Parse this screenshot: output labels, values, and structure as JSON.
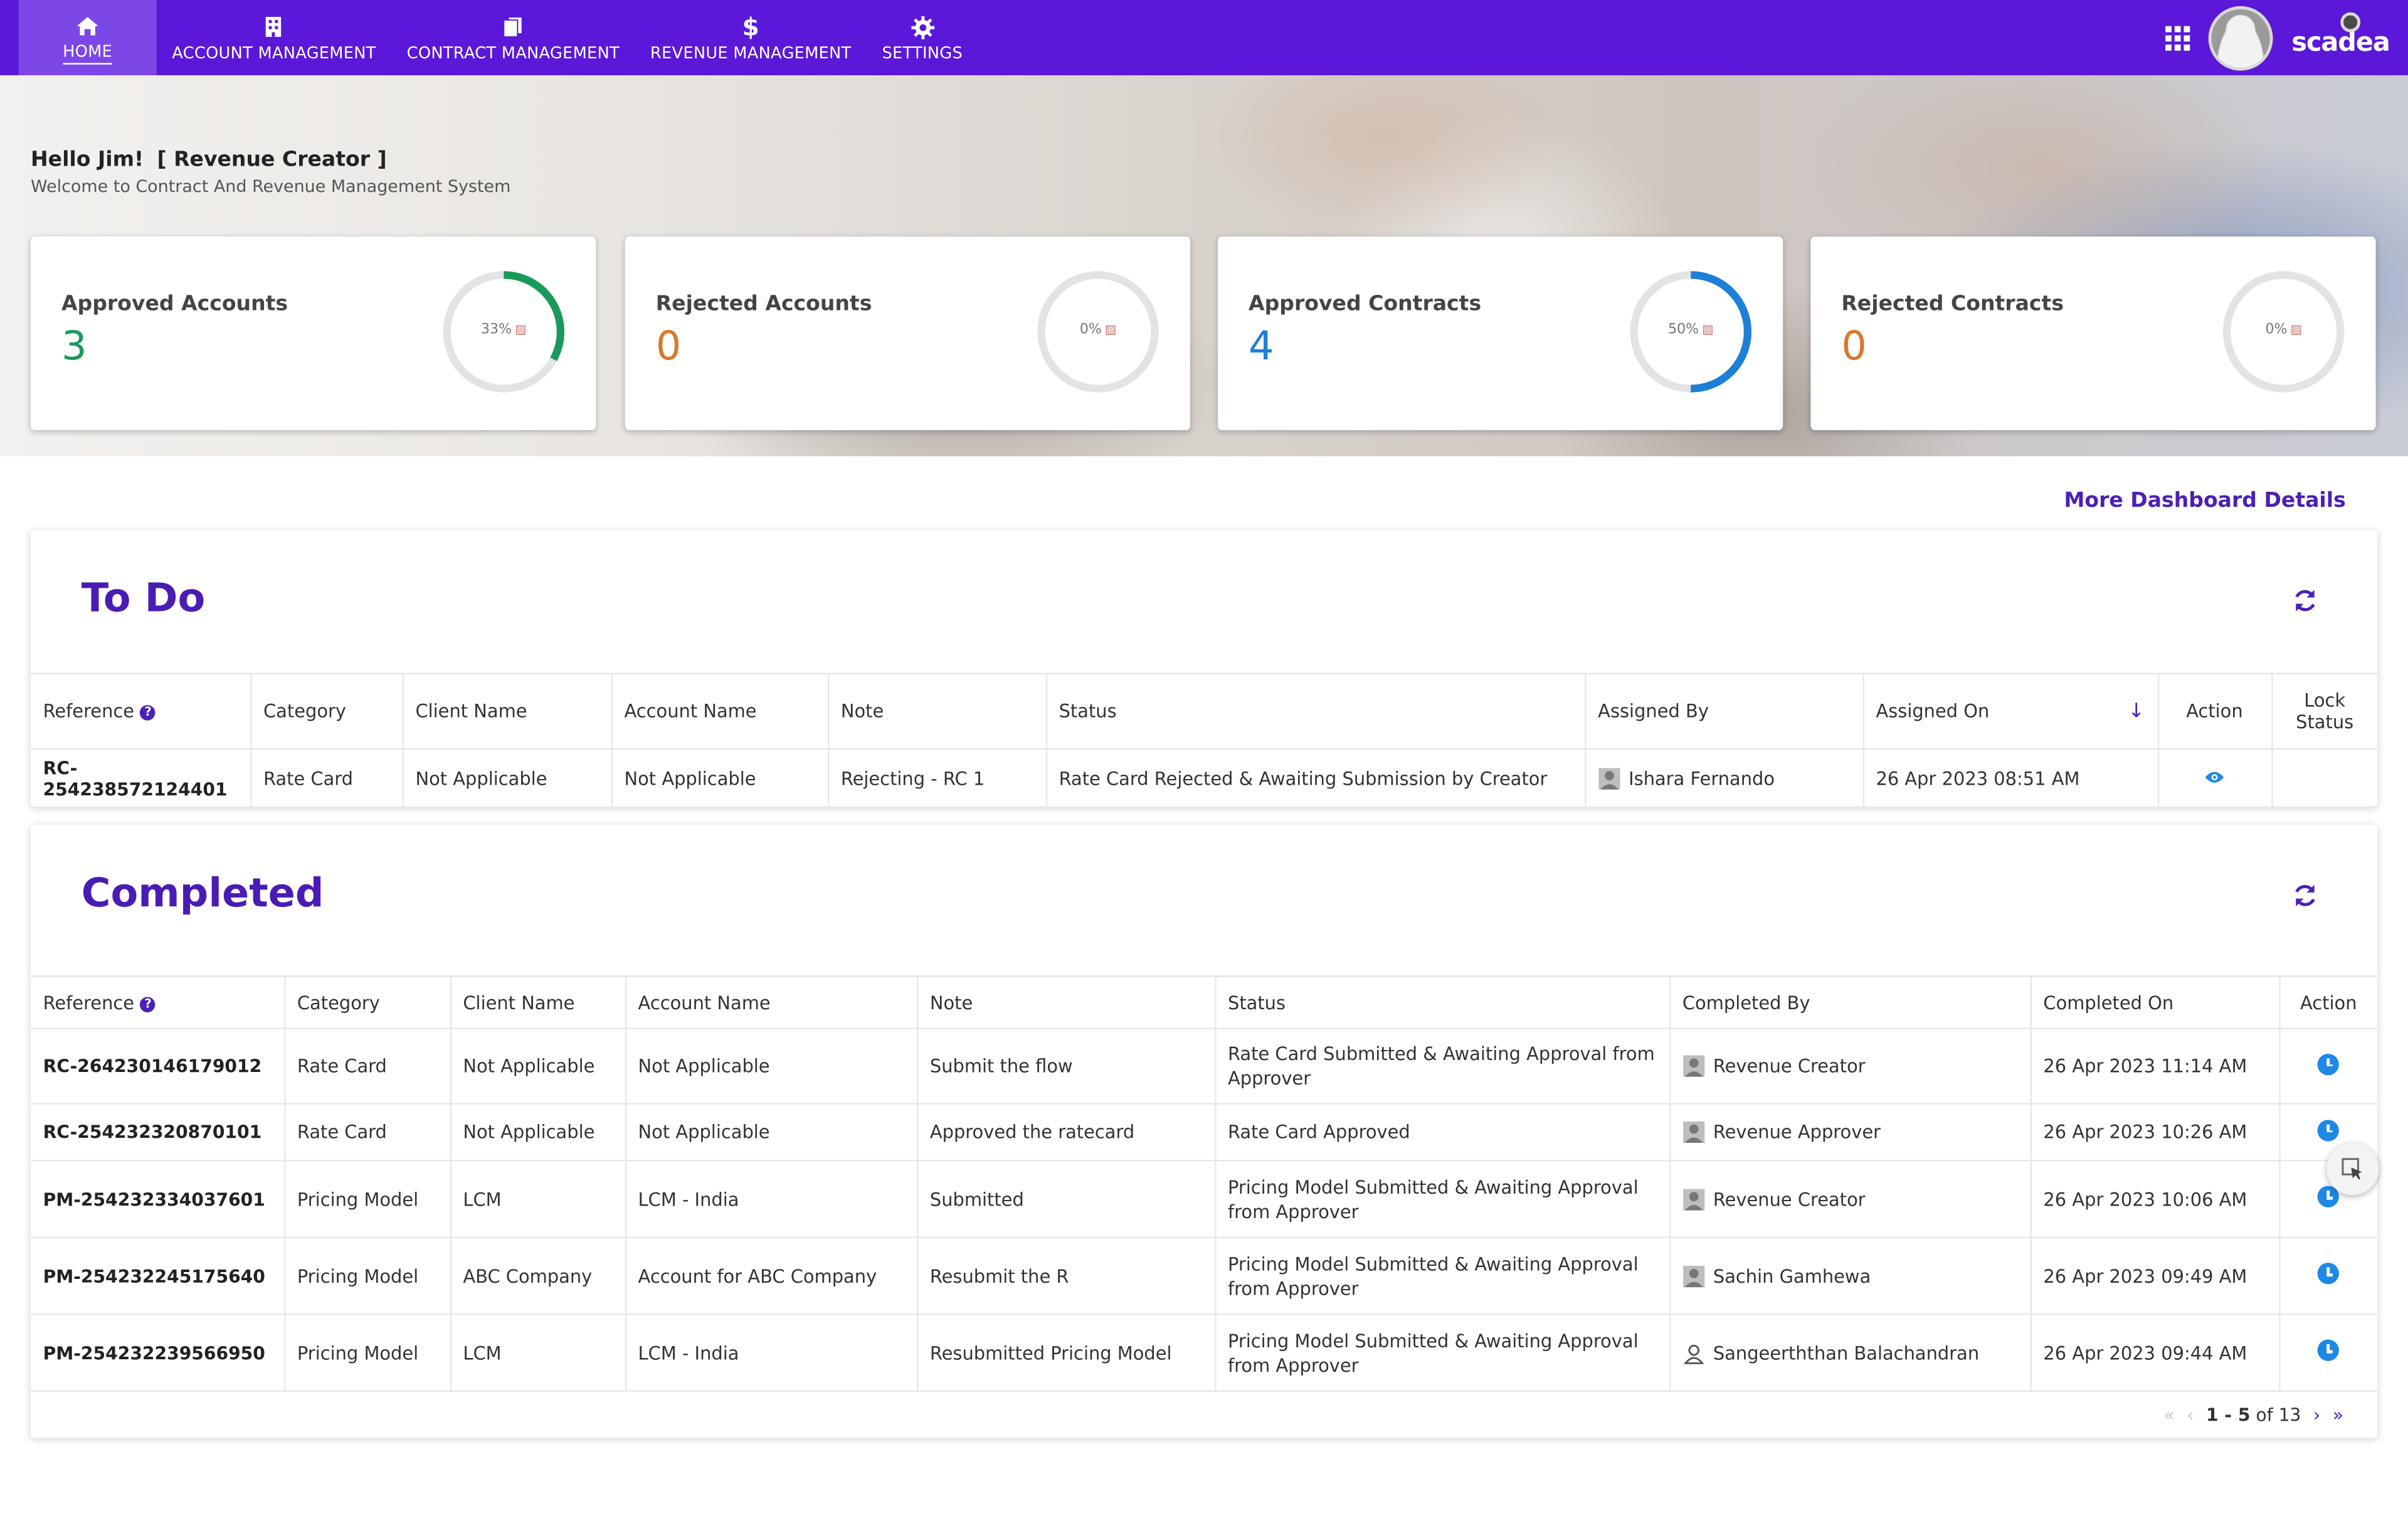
{
  "nav": {
    "items": [
      {
        "label": "HOME",
        "icon": "home-icon",
        "active": true
      },
      {
        "label": "ACCOUNT MANAGEMENT",
        "icon": "building-icon"
      },
      {
        "label": "CONTRACT MANAGEMENT",
        "icon": "document-icon"
      },
      {
        "label": "REVENUE MANAGEMENT",
        "icon": "dollar-icon"
      },
      {
        "label": "SETTINGS",
        "icon": "gear-icon"
      }
    ],
    "brand": "scadea",
    "accent": "#5b18d8"
  },
  "hero": {
    "greeting": "Hello Jim!",
    "role": "[ Revenue Creator ]",
    "welcome": "Welcome to Contract And Revenue Management System"
  },
  "stats": [
    {
      "label": "Approved Accounts",
      "value": "3",
      "percent_text": "33%",
      "percent": 33,
      "color": "#1a9a5a",
      "value_color": "#1a9a5a"
    },
    {
      "label": "Rejected Accounts",
      "value": "0",
      "percent_text": "0%",
      "percent": 0,
      "color": "#d9d9d9",
      "value_color": "#d9782a"
    },
    {
      "label": "Approved Contracts",
      "value": "4",
      "percent_text": "50%",
      "percent": 50,
      "color": "#1e7fd6",
      "value_color": "#1e7fd6"
    },
    {
      "label": "Rejected Contracts",
      "value": "0",
      "percent_text": "0%",
      "percent": 0,
      "color": "#d9d9d9",
      "value_color": "#d9782a"
    }
  ],
  "more_link": "More Dashboard Details",
  "todo": {
    "title": "To Do",
    "columns": [
      "Reference",
      "Category",
      "Client Name",
      "Account Name",
      "Note",
      "Status",
      "Assigned By",
      "Assigned On",
      "Action",
      "Lock Status"
    ],
    "rows": [
      {
        "reference": "RC-254238572124401",
        "category": "Rate Card",
        "client": "Not Applicable",
        "account": "Not Applicable",
        "note": "Rejecting - RC 1",
        "status": "Rate Card Rejected & Awaiting Submission by Creator",
        "by": "Ishara Fernando",
        "on": "26 Apr 2023 08:51 AM"
      }
    ]
  },
  "completed": {
    "title": "Completed",
    "columns": [
      "Reference",
      "Category",
      "Client Name",
      "Account Name",
      "Note",
      "Status",
      "Completed By",
      "Completed On",
      "Action"
    ],
    "rows": [
      {
        "reference": "RC-264230146179012",
        "category": "Rate Card",
        "client": "Not Applicable",
        "account": "Not Applicable",
        "note": "Submit the flow",
        "status": "Rate Card Submitted & Awaiting Approval from Approver",
        "by": "Revenue Creator",
        "on": "26 Apr 2023 11:14 AM"
      },
      {
        "reference": "RC-254232320870101",
        "category": "Rate Card",
        "client": "Not Applicable",
        "account": "Not Applicable",
        "note": "Approved the ratecard",
        "status": "Rate Card Approved",
        "by": "Revenue Approver",
        "on": "26 Apr 2023 10:26 AM"
      },
      {
        "reference": "PM-254232334037601",
        "category": "Pricing Model",
        "client": "LCM",
        "account": "LCM - India",
        "note": "Submitted",
        "status": "Pricing Model Submitted & Awaiting Approval from Approver",
        "by": "Revenue Creator",
        "on": "26 Apr 2023 10:06 AM"
      },
      {
        "reference": "PM-254232245175640",
        "category": "Pricing Model",
        "client": "ABC Company",
        "account": "Account for ABC Company",
        "note": "Resubmit the R",
        "status": "Pricing Model Submitted & Awaiting Approval from Approver",
        "by": "Sachin Gamhewa",
        "on": "26 Apr 2023 09:49 AM"
      },
      {
        "reference": "PM-254232239566950",
        "category": "Pricing Model",
        "client": "LCM",
        "account": "LCM - India",
        "note": "Resubmitted Pricing Model",
        "status": "Pricing Model Submitted & Awaiting Approval from Approver",
        "by": "Sangeerththan Balachandran",
        "on": "26 Apr 2023 09:44 AM"
      }
    ],
    "pager": {
      "range": "1 - 5",
      "of_text": "of 13"
    }
  }
}
